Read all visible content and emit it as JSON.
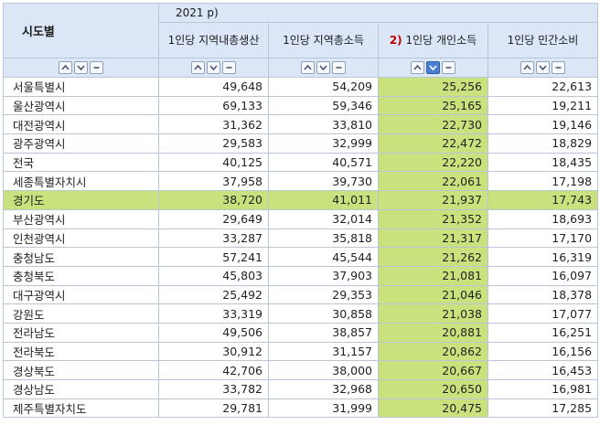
{
  "table": {
    "region_header": "시도별",
    "year_header": "2021 p)",
    "columns": [
      {
        "label": "1인당 지역내총생산",
        "note": ""
      },
      {
        "label": "1인당 지역총소득",
        "note": ""
      },
      {
        "label": "1인당 개인소득",
        "note": "2)"
      },
      {
        "label": "1인당 민간소비",
        "note": ""
      }
    ],
    "sorted_column": 2,
    "highlighted_row": 6,
    "rows": [
      {
        "region": "서울특별시",
        "values": [
          "49,648",
          "54,209",
          "25,256",
          "22,613"
        ]
      },
      {
        "region": "울산광역시",
        "values": [
          "69,133",
          "59,346",
          "25,165",
          "19,211"
        ]
      },
      {
        "region": "대전광역시",
        "values": [
          "31,362",
          "33,810",
          "22,730",
          "19,146"
        ]
      },
      {
        "region": "광주광역시",
        "values": [
          "29,583",
          "32,999",
          "22,472",
          "18,829"
        ]
      },
      {
        "region": "전국",
        "values": [
          "40,125",
          "40,571",
          "22,220",
          "18,435"
        ]
      },
      {
        "region": "세종특별자치시",
        "values": [
          "37,958",
          "39,730",
          "22,061",
          "17,198"
        ]
      },
      {
        "region": "경기도",
        "values": [
          "38,720",
          "41,011",
          "21,937",
          "17,743"
        ]
      },
      {
        "region": "부산광역시",
        "values": [
          "29,649",
          "32,014",
          "21,352",
          "18,693"
        ]
      },
      {
        "region": "인천광역시",
        "values": [
          "33,287",
          "35,818",
          "21,317",
          "17,170"
        ]
      },
      {
        "region": "충청남도",
        "values": [
          "57,241",
          "45,544",
          "21,262",
          "16,319"
        ]
      },
      {
        "region": "충청북도",
        "values": [
          "45,803",
          "37,903",
          "21,081",
          "16,097"
        ]
      },
      {
        "region": "대구광역시",
        "values": [
          "25,492",
          "29,353",
          "21,046",
          "18,378"
        ]
      },
      {
        "region": "강원도",
        "values": [
          "33,319",
          "30,858",
          "21,038",
          "17,077"
        ]
      },
      {
        "region": "전라남도",
        "values": [
          "49,506",
          "38,857",
          "20,881",
          "16,251"
        ]
      },
      {
        "region": "전라북도",
        "values": [
          "30,912",
          "31,157",
          "20,862",
          "16,156"
        ]
      },
      {
        "region": "경상북도",
        "values": [
          "42,706",
          "38,000",
          "20,667",
          "16,453"
        ]
      },
      {
        "region": "경상남도",
        "values": [
          "33,782",
          "32,968",
          "20,650",
          "16,981"
        ]
      },
      {
        "region": "제주특별자치도",
        "values": [
          "29,781",
          "31,999",
          "20,475",
          "17,285"
        ]
      }
    ]
  },
  "controls": {
    "icons": [
      "sort-ascending-icon",
      "sort-descending-icon",
      "collapse-icon"
    ]
  },
  "colors": {
    "header_bg": "#dbe6f6",
    "highlight": "#c9e27e",
    "border": "#b9c6d8",
    "note": "#c00000",
    "active_button": "#4a7fd4"
  }
}
